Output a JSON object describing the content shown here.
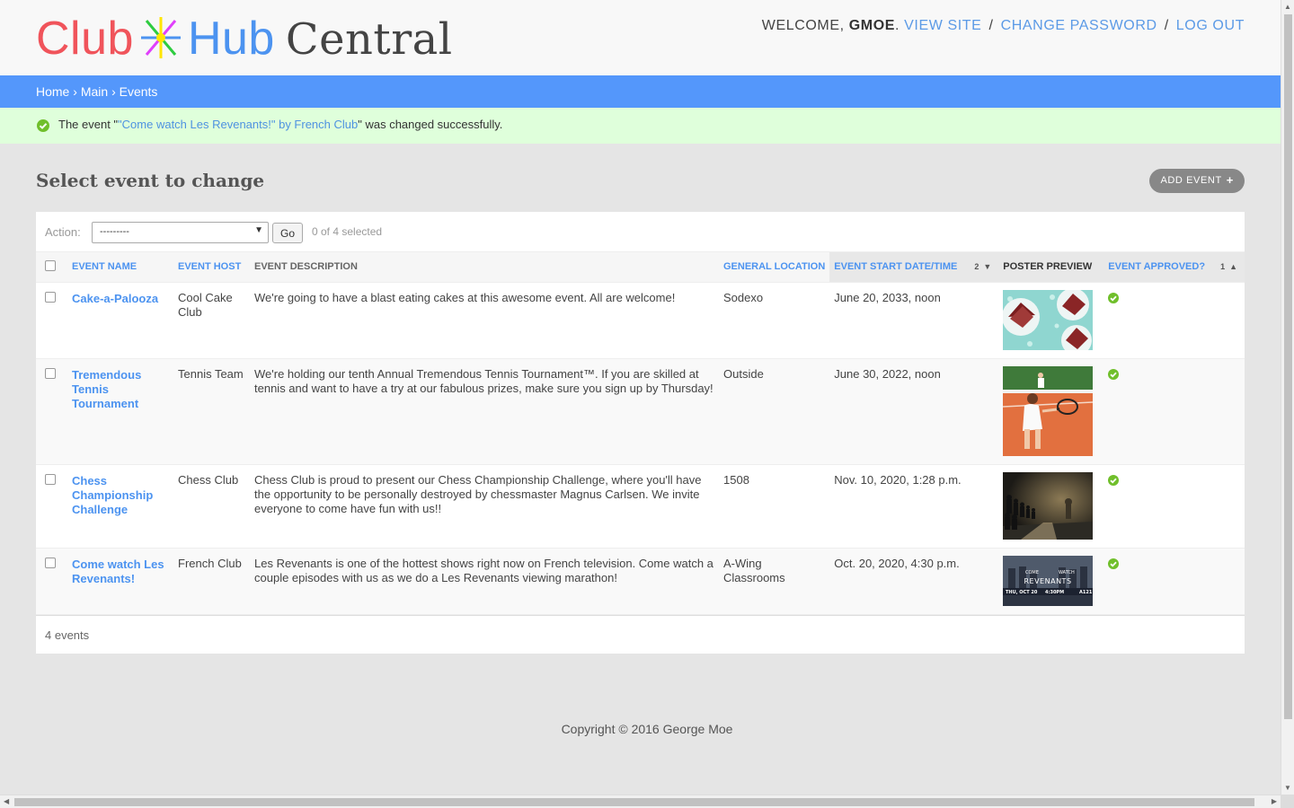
{
  "header": {
    "logo": {
      "part1": "Club",
      "part2": "Hub",
      "part3": "Central"
    },
    "user_tools": {
      "welcome": "WELCOME,",
      "username": "GMOE",
      "period": ".",
      "view_site": "VIEW SITE",
      "change_password": "CHANGE PASSWORD",
      "log_out": "LOG OUT",
      "separator": "/"
    }
  },
  "breadcrumbs": {
    "home": "Home",
    "main": "Main",
    "events": "Events",
    "sep": "›"
  },
  "message": {
    "prefix": "The event \"",
    "link": "\"Come watch Les Revenants!\" by French Club",
    "suffix": "\" was changed successfully."
  },
  "page": {
    "title": "Select event to change",
    "add_button": "ADD EVENT"
  },
  "actions": {
    "label": "Action:",
    "selected": "---------",
    "go": "Go",
    "counter": "0 of 4 selected"
  },
  "columns": {
    "event_name": "EVENT NAME",
    "event_host": "EVENT HOST",
    "event_description": "EVENT DESCRIPTION",
    "general_location": "GENERAL LOCATION",
    "event_start": "EVENT START DATE/TIME",
    "event_start_sort": "2",
    "poster_preview": "POSTER PREVIEW",
    "event_approved": "EVENT APPROVED?",
    "event_approved_sort": "1"
  },
  "rows": [
    {
      "name": "Cake-a-Palooza",
      "host": "Cool Cake Club",
      "description": "We're going to have a blast eating cakes at this awesome event. All are welcome!",
      "location": "Sodexo",
      "start": "June 20, 2033, noon",
      "poster": "cake"
    },
    {
      "name": "Tremendous Tennis Tournament",
      "host": "Tennis Team",
      "description": "We're holding our tenth Annual Tremendous Tennis Tournament™. If you are skilled at tennis and want to have a try at our fabulous prizes, make sure you sign up by Thursday!",
      "location": "Outside",
      "start": "June 30, 2022, noon",
      "poster": "tennis"
    },
    {
      "name": "Chess Championship Challenge",
      "host": "Chess Club",
      "description": "Chess Club is proud to present our Chess Championship Challenge, where you'll have the opportunity to be personally destroyed by chessmaster Magnus Carlsen. We invite everyone to come have fun with us!!",
      "location": "1508",
      "start": "Nov. 10, 2020, 1:28 p.m.",
      "poster": "chess"
    },
    {
      "name": "Come watch Les Revenants!",
      "host": "French Club",
      "description": "Les Revenants is one of the hottest shows right now on French television. Come watch a couple episodes with us as we do a Les Revenants viewing marathon!",
      "location": "A-Wing Classrooms",
      "start": "Oct. 20, 2020, 4:30 p.m.",
      "poster": "revenants",
      "poster_text": {
        "line1": "COME",
        "line2": "WATCH",
        "line3": "REVENANTS",
        "date": "THU, OCT 20",
        "time": "4:30PM",
        "room": "A121"
      }
    }
  ],
  "paginator": "4 events",
  "footer": "Copyright © 2016 George Moe",
  "colors": {
    "accent": "#5497fb",
    "link": "#4c93f0",
    "success_bg": "#dfffdb",
    "approved": "#70bf2b",
    "logo_red": "#f0545b",
    "logo_blue": "#4c93f0"
  }
}
